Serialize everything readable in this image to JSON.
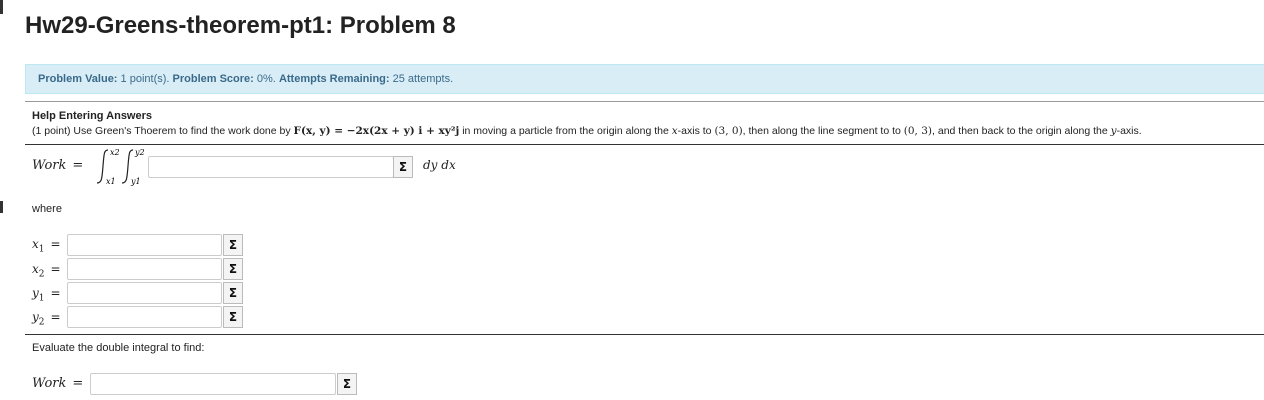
{
  "page_title": "Hw29-Greens-theorem-pt1: Problem 8",
  "info": {
    "value_label": "Problem Value:",
    "value_text": "1 point(s).",
    "score_label": "Problem Score:",
    "score_text": "0%.",
    "attempts_label": "Attempts Remaining:",
    "attempts_text": "25 attempts."
  },
  "help_link": "Help Entering Answers",
  "statement": {
    "part1": "(1 point) Use Green's Thoerem to find the work done by ",
    "field": "F(x, y) = −2x(2x + y) i + xy²j",
    "part2": " in moving a particle from the origin along the ",
    "xaxis": "x",
    "part3": "-axis to ",
    "p1": "(3, 0)",
    "part4": ", then along the line segment to to ",
    "p2": "(0, 3)",
    "part5": ", and then back to the origin along the ",
    "yaxis": "y",
    "part6": "-axis."
  },
  "work_label": "Work",
  "equals": "=",
  "integral": {
    "outer_upper": "x2",
    "outer_lower": "x1",
    "inner_upper": "y2",
    "inner_lower": "y1"
  },
  "differentials": "dy dx",
  "sigma_symbol": "Σ",
  "where_text": "where",
  "variables": [
    {
      "name": "x",
      "sub": "1"
    },
    {
      "name": "x",
      "sub": "2"
    },
    {
      "name": "y",
      "sub": "1"
    },
    {
      "name": "y",
      "sub": "2"
    }
  ],
  "inputs": {
    "integrand": "",
    "x1": "",
    "x2": "",
    "y1": "",
    "y2": "",
    "work": ""
  },
  "evaluate_text": "Evaluate the double integral to find:"
}
